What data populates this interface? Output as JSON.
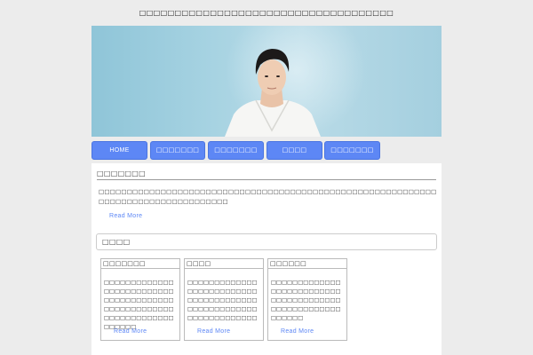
{
  "site": {
    "title": "□□□□□□□□□□□□□□□□□□□□□□□□□□□□□□□□□□□□"
  },
  "nav": {
    "items": [
      {
        "label": "HOME"
      },
      {
        "label": "□□□□□□□"
      },
      {
        "label": "□□□□□□□"
      },
      {
        "label": "□□□□"
      },
      {
        "label": "□□□□□□□"
      }
    ]
  },
  "main": {
    "intro_heading": "□□□□□□□",
    "intro_text": "□□□□□□□□□□□□□□□□□□□□□□□□□□□□□□□□□□□□□□□□□□□□□□□□□□□□□□□□□□□□□□□□□□□□□□□□□□□□□□□□□□□",
    "intro_read_more": "Read More",
    "feature_heading": "□□□□",
    "cards": [
      {
        "title": "□□□□□□□",
        "text": "□□□□□□□□□□□□□□□□□□□□□□□□□□□□□□□□□□□□□□□□□□□□□□□□□□□□□□□□□□□□□□□□□□□□□□□",
        "read_more": "Read More"
      },
      {
        "title": "□□□□",
        "text": "□□□□□□□□□□□□□□□□□□□□□□□□□□□□□□□□□□□□□□□□□□□□□□□□□□□□□□□□□□□□□□□□□",
        "read_more": "Read More"
      },
      {
        "title": "□□□□□□",
        "text": "□□□□□□□□□□□□□□□□□□□□□□□□□□□□□□□□□□□□□□□□□□□□□□□□□□□□□□□□□□",
        "read_more": "Read More"
      }
    ]
  },
  "colors": {
    "accent": "#5d87f5",
    "background": "#ececec",
    "hero_sky": "#a7d3e2"
  }
}
